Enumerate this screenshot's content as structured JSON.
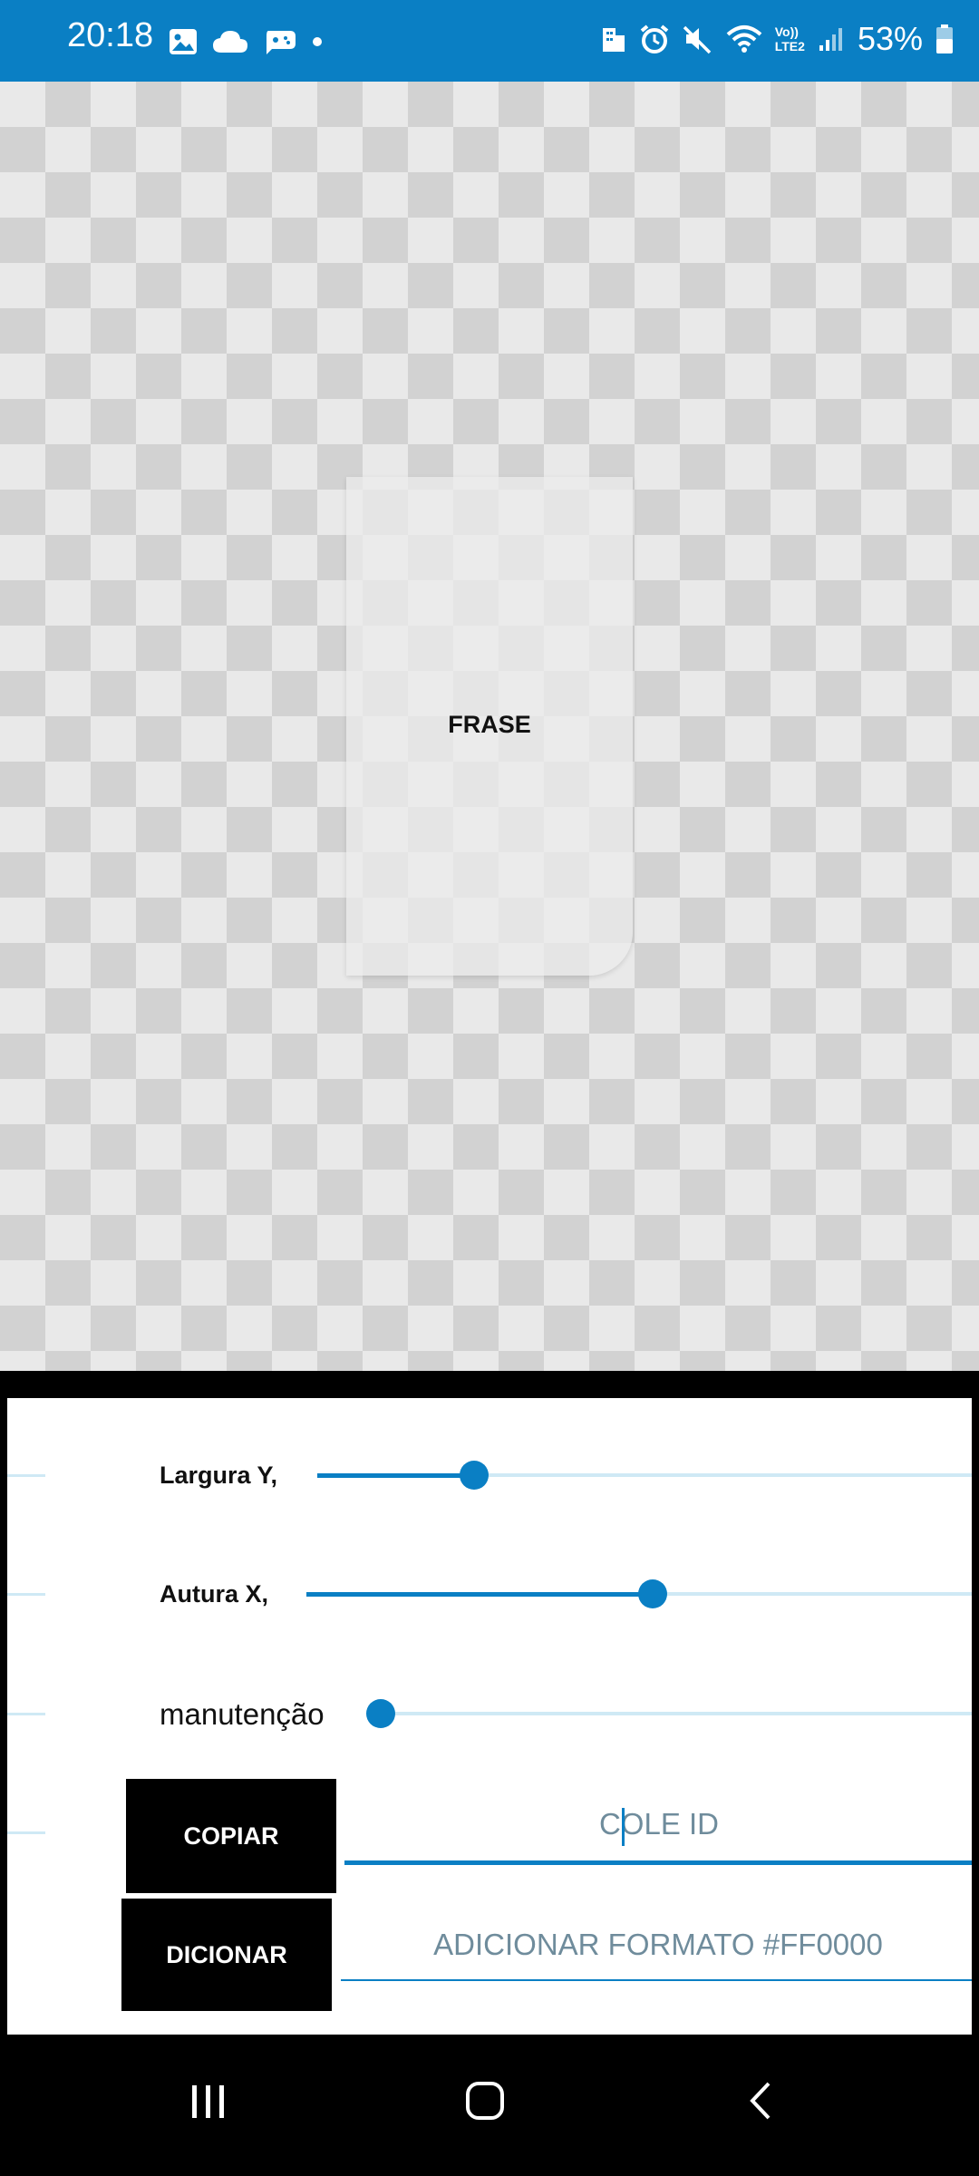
{
  "status_bar": {
    "time": "20:18",
    "battery": "53%",
    "net_label_top": "Vo))",
    "net_label_bottom": "LTE2",
    "left_icons": [
      "gallery-icon",
      "cloud-icon",
      "game-icon",
      "dot-icon"
    ],
    "right_icons": [
      "building-icon",
      "alarm-icon",
      "mute-icon",
      "wifi-icon",
      "volte-icon",
      "signal-icon",
      "battery-icon"
    ]
  },
  "canvas": {
    "card_label": "FRASE"
  },
  "controls": {
    "sliders": [
      {
        "label": "Largura Y,",
        "value": 0.24
      },
      {
        "label": "Autura X,",
        "value": 0.52
      },
      {
        "label": "manutenção",
        "value": 0.0
      }
    ],
    "copy_button": "COPIAR",
    "id_field_placeholder": "COLE ID",
    "add_button": "DICIONAR",
    "format_field_placeholder": "ADICIONAR FORMATO #FF0000"
  },
  "nav_bar": {
    "items": [
      "recents-icon",
      "home-icon",
      "back-icon"
    ]
  },
  "colors": {
    "accent": "#0a7fc4",
    "track": "#cfe9f5",
    "button": "#000000"
  }
}
